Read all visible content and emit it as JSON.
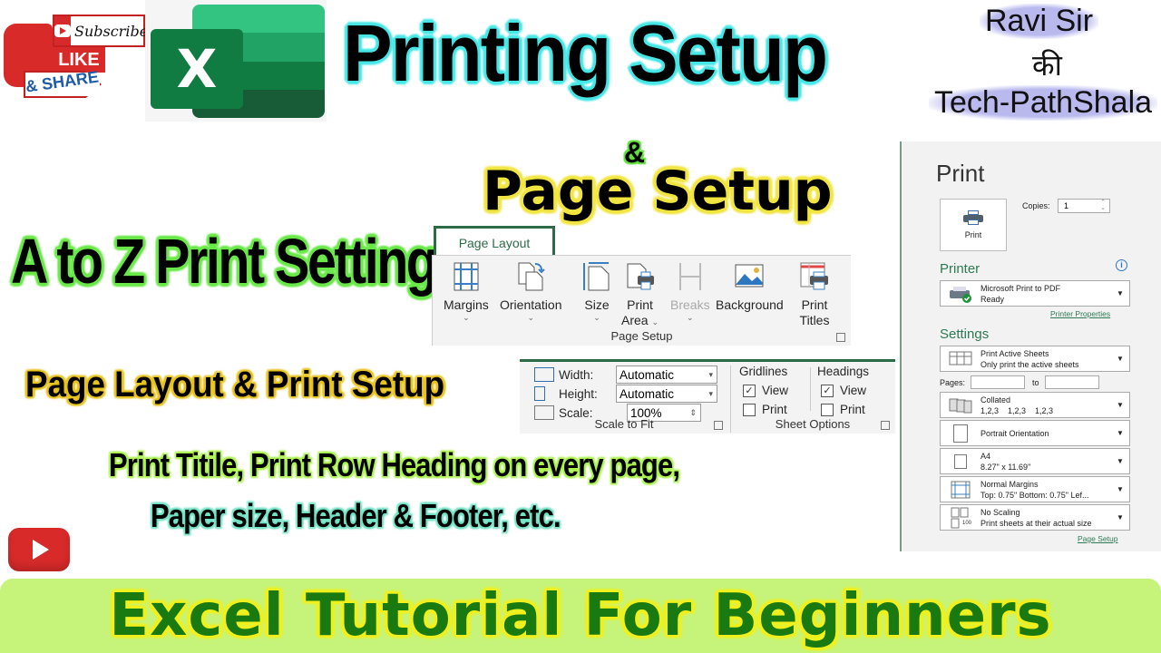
{
  "badge": {
    "subscribe": "Subscribe",
    "like": "LIKE",
    "share": "& SHARE"
  },
  "excel_logo": {
    "letter": "X",
    "colors": [
      "#33c481",
      "#21a366",
      "#107c41",
      "#185c37"
    ]
  },
  "titles": {
    "main": "Printing Setup",
    "ampersand": "&",
    "sub": "Page Setup",
    "a_to_z": "A to Z Print Setting",
    "layout": "Page Layout & Print Setup",
    "desc_line1": "Print Titile, Print Row Heading on every page,",
    "desc_line2": "Paper size, Header & Footer, etc."
  },
  "brand": {
    "line1": "Ravi Sir",
    "line2": "की",
    "line3": "Tech-PathShala"
  },
  "ribbon": {
    "tab": "Page Layout",
    "buttons": [
      {
        "label": "Margins",
        "label2": "",
        "icon": "margins-icon",
        "dropdown": true,
        "enabled": true
      },
      {
        "label": "Orientation",
        "label2": "",
        "icon": "orientation-icon",
        "dropdown": true,
        "enabled": true
      },
      {
        "label": "Size",
        "label2": "",
        "icon": "size-icon",
        "dropdown": true,
        "enabled": true
      },
      {
        "label": "Print",
        "label2": "Area",
        "icon": "print-area-icon",
        "dropdown": true,
        "enabled": true
      },
      {
        "label": "Breaks",
        "label2": "",
        "icon": "breaks-icon",
        "dropdown": true,
        "enabled": false
      },
      {
        "label": "Background",
        "label2": "",
        "icon": "background-icon",
        "dropdown": false,
        "enabled": true
      },
      {
        "label": "Print",
        "label2": "Titles",
        "icon": "print-titles-icon",
        "dropdown": false,
        "enabled": true
      }
    ],
    "group_label": "Page Setup",
    "chevron": "⌄"
  },
  "scale_to_fit": {
    "width_label": "Width:",
    "width_value": "Automatic",
    "height_label": "Height:",
    "height_value": "Automatic",
    "scale_label": "Scale:",
    "scale_value": "100%",
    "group_label": "Scale to Fit"
  },
  "sheet_options": {
    "gridlines": "Gridlines",
    "headings": "Headings",
    "view": "View",
    "print": "Print",
    "gridlines_view": true,
    "gridlines_print": false,
    "headings_view": true,
    "headings_print": false,
    "group_label": "Sheet Options"
  },
  "print_panel": {
    "title": "Print",
    "print_button": "Print",
    "copies_label": "Copies:",
    "copies_value": "1",
    "printer_section": "Printer",
    "printer_name": "Microsoft Print to PDF",
    "printer_status": "Ready",
    "printer_properties": "Printer Properties",
    "settings_section": "Settings",
    "what_to_print": "Print Active Sheets",
    "what_to_print_desc": "Only print the active sheets",
    "pages_label": "Pages:",
    "to_label": "to",
    "collation": "Collated",
    "collation_desc": "1,2,3    1,2,3    1,2,3",
    "orientation": "Portrait Orientation",
    "paper": "A4",
    "paper_desc": "8.27\" x 11.69\"",
    "margins": "Normal Margins",
    "margins_desc": "Top: 0.75\" Bottom: 0.75\" Lef...",
    "scaling": "No Scaling",
    "scaling_desc": "Print sheets at their actual size",
    "scaling_badge": "100",
    "page_setup_link": "Page Setup",
    "accent": "#2c7a52"
  },
  "banner": {
    "text": "Excel Tutorial For Beginners"
  }
}
